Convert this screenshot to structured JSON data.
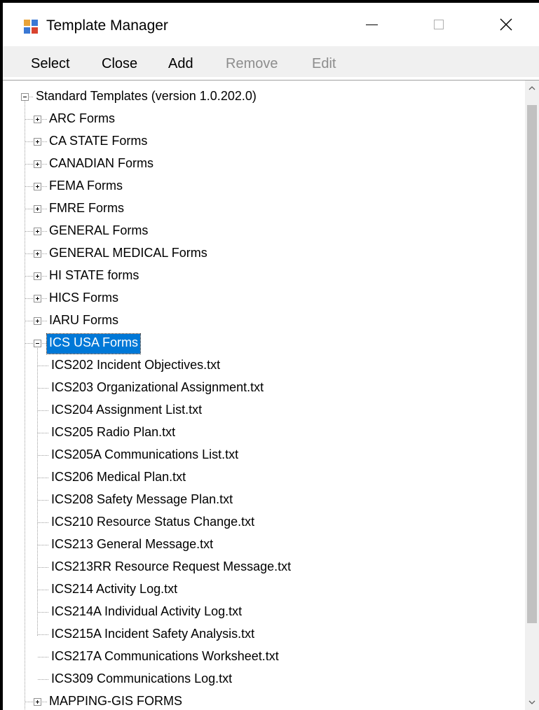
{
  "window": {
    "title": "Template Manager",
    "icon": "app-window-icon"
  },
  "titlebar_buttons": [
    "minimize-icon",
    "maximize-icon",
    "close-icon"
  ],
  "menu": [
    {
      "label": "Select",
      "enabled": true
    },
    {
      "label": "Close",
      "enabled": true
    },
    {
      "label": "Add",
      "enabled": true
    },
    {
      "label": "Remove",
      "enabled": false
    },
    {
      "label": "Edit",
      "enabled": false
    }
  ],
  "tree": {
    "root": {
      "label": "Standard Templates (version 1.0.202.0)",
      "expanded": true
    },
    "categories": [
      {
        "label": "ARC Forms",
        "expanded": false
      },
      {
        "label": "CA STATE Forms",
        "expanded": false
      },
      {
        "label": "CANADIAN Forms",
        "expanded": false
      },
      {
        "label": "FEMA Forms",
        "expanded": false
      },
      {
        "label": "FMRE Forms",
        "expanded": false
      },
      {
        "label": "GENERAL Forms",
        "expanded": false
      },
      {
        "label": "GENERAL MEDICAL Forms",
        "expanded": false
      },
      {
        "label": "HI STATE forms",
        "expanded": false
      },
      {
        "label": "HICS Forms",
        "expanded": false
      },
      {
        "label": "IARU Forms",
        "expanded": false
      },
      {
        "label": "ICS USA Forms",
        "expanded": true,
        "selected": true
      },
      {
        "label": "MAPPING-GIS FORMS",
        "expanded": false
      }
    ],
    "ics_usa_children": [
      "ICS202 Incident Objectives.txt",
      "ICS203 Organizational Assignment.txt",
      "ICS204 Assignment List.txt",
      "ICS205 Radio Plan.txt",
      "ICS205A Communications List.txt",
      "ICS206 Medical Plan.txt",
      "ICS208 Safety Message Plan.txt",
      "ICS210 Resource Status Change.txt",
      "ICS213 General Message.txt",
      "ICS213RR Resource Request Message.txt",
      "ICS214 Activity Log.txt",
      "ICS214A Individual Activity Log.txt",
      "ICS215A Incident Safety Analysis.txt",
      "ICS217A Communications Worksheet.txt",
      "ICS309 Communications Log.txt"
    ]
  },
  "colors": {
    "selection": "#0078d7",
    "menubar": "#f0f0f0",
    "disabled_text": "#8d8d8d"
  }
}
